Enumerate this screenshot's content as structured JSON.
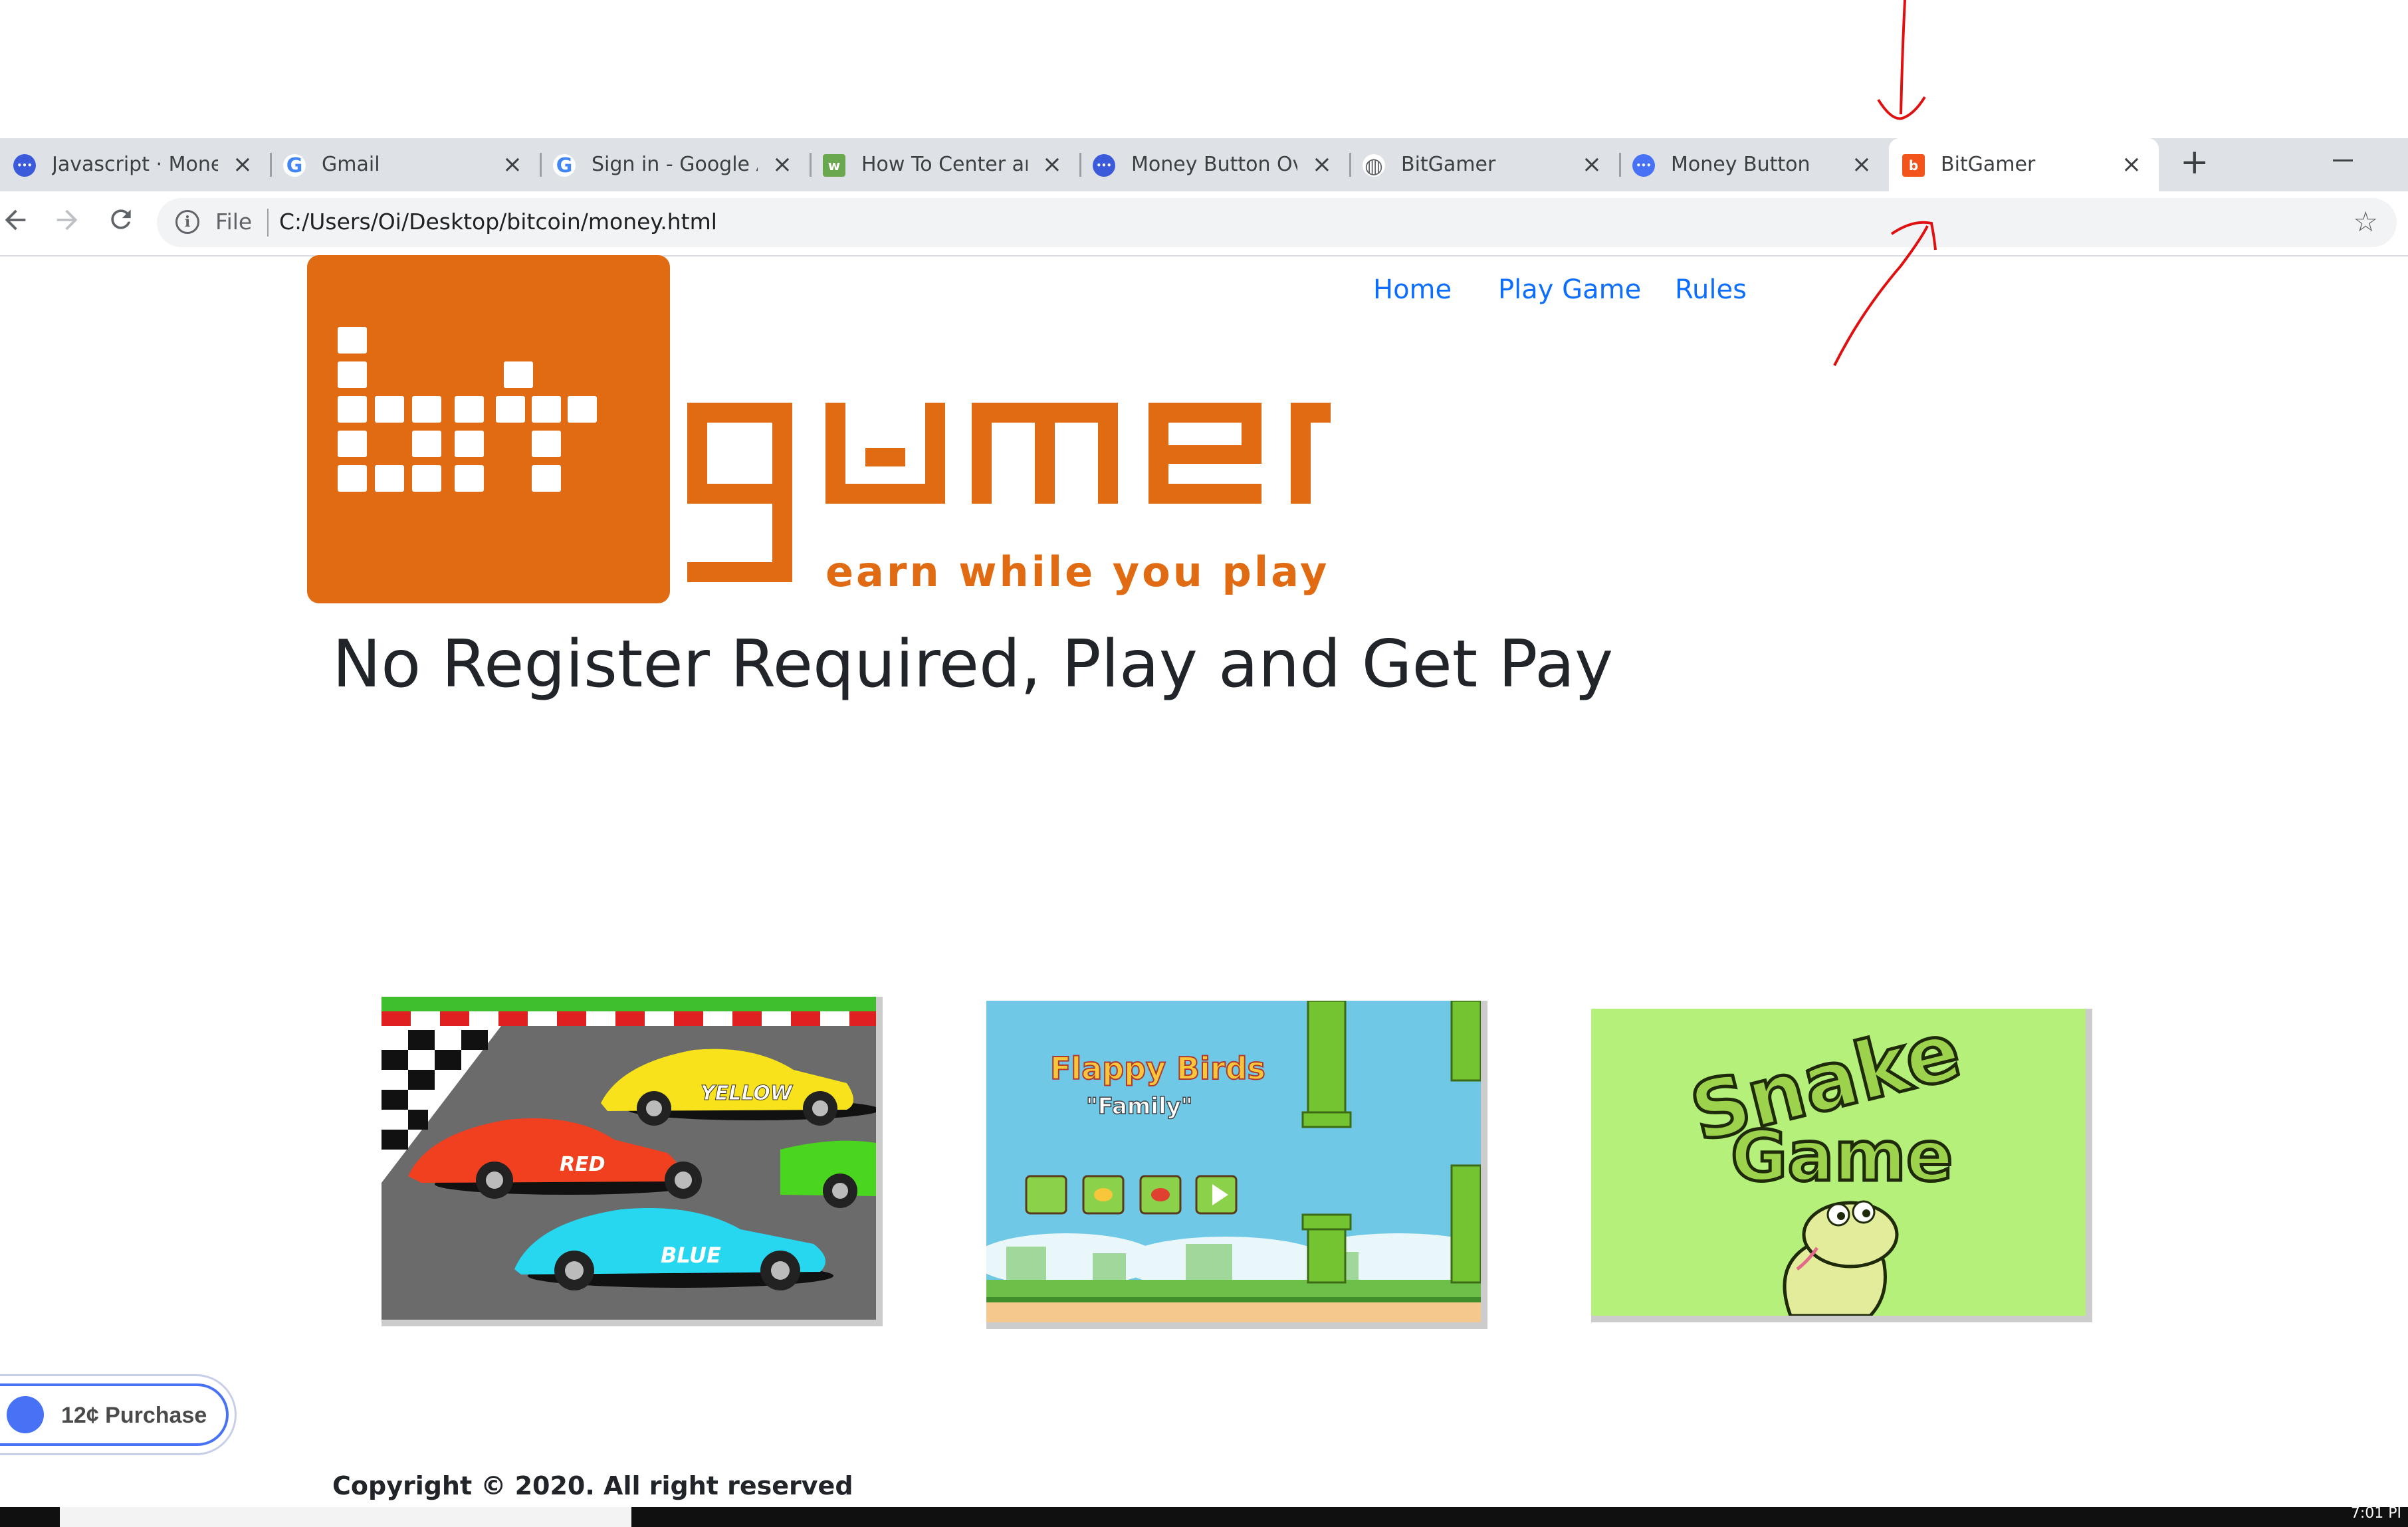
{
  "browser": {
    "tabs": [
      {
        "title": "Javascript · Money",
        "favicon": "moneybutton-icon",
        "color": "#3b5bdb"
      },
      {
        "title": "Gmail",
        "favicon": "google-icon",
        "color": "#4285f4"
      },
      {
        "title": "Sign in - Google A",
        "favicon": "google-icon",
        "color": "#4285f4"
      },
      {
        "title": "How To Center an",
        "favicon": "w3schools-icon",
        "color": "#6aa84f"
      },
      {
        "title": "Money Button Ove",
        "favicon": "moneybutton-icon",
        "color": "#3b5bdb"
      },
      {
        "title": "BitGamer",
        "favicon": "globe-icon",
        "color": "#5f6368"
      },
      {
        "title": "Money Button",
        "favicon": "moneybutton-icon",
        "color": "#4772f6"
      },
      {
        "title": "BitGamer",
        "favicon": "bitgamer-icon",
        "color": "#f2541b"
      }
    ],
    "active_tab_index": 7,
    "address": {
      "scheme_label": "File",
      "url": "C:/Users/Oi/Desktop/bitcoin/money.html"
    },
    "icons": {
      "back": "arrow-left-icon",
      "forward": "arrow-right-icon",
      "reload": "reload-icon",
      "info": "info-icon",
      "bookmark": "star-icon",
      "new_tab": "plus-icon",
      "minimize": "minimize-icon"
    }
  },
  "page": {
    "nav": [
      "Home",
      "Play Game",
      "Rules"
    ],
    "logo": {
      "wordmark": "bitgamer",
      "tagline": "earn while you play",
      "brand_color": "#e06b12"
    },
    "headline": "No Register Required, Play and Get Pay",
    "games": [
      {
        "name": "car-racing",
        "car_labels": [
          "YELLOW",
          "RED",
          "BLUE"
        ]
      },
      {
        "name": "flappy-birds",
        "title": "Flappy Birds",
        "subtitle": "Family"
      },
      {
        "name": "snake-game",
        "title_line1": "Snake",
        "title_line2": "Game"
      }
    ],
    "purchase_button": {
      "label": "12¢ Purchase",
      "accent": "#4772f6"
    },
    "copyright": "Copyright © 2020. All right reserved"
  },
  "taskbar": {
    "clock": "7:01 PI"
  },
  "colors": {
    "link": "#0d6efd",
    "annotation": "#e01010",
    "text": "#212529"
  }
}
